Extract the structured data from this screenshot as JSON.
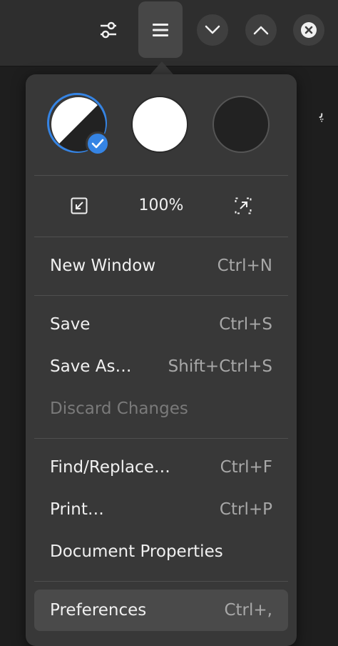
{
  "header": {
    "icons": [
      "sliders-icon",
      "hamburger-menu-icon",
      "chevron-down-icon",
      "chevron-up-icon",
      "close-icon"
    ]
  },
  "content": {
    "glyph": "ﭘ"
  },
  "style_options": [
    {
      "name": "follow-system",
      "selected": true
    },
    {
      "name": "light",
      "selected": false
    },
    {
      "name": "dark",
      "selected": false
    }
  ],
  "zoom": {
    "level": "100%"
  },
  "menu": {
    "new_window": {
      "label": "New Window",
      "accel": "Ctrl+N"
    },
    "save": {
      "label": "Save",
      "accel": "Ctrl+S"
    },
    "save_as": {
      "label": "Save As…",
      "accel": "Shift+Ctrl+S"
    },
    "discard": {
      "label": "Discard Changes",
      "accel": ""
    },
    "find_replace": {
      "label": "Find/Replace…",
      "accel": "Ctrl+F"
    },
    "print": {
      "label": "Print…",
      "accel": "Ctrl+P"
    },
    "doc_props": {
      "label": "Document Properties",
      "accel": ""
    },
    "preferences": {
      "label": "Preferences",
      "accel": "Ctrl+,"
    }
  },
  "colors": {
    "accent": "#3584e4",
    "popover_bg": "#383838",
    "header_bg": "#2e2e2e"
  }
}
